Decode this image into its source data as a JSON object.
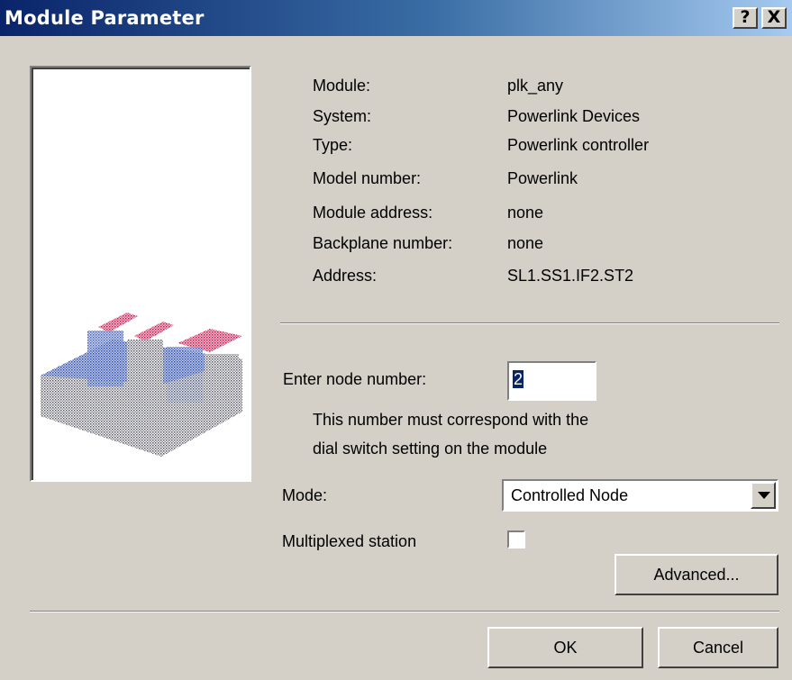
{
  "window": {
    "title": "Module Parameter",
    "help_glyph": "?",
    "close_glyph": "X"
  },
  "picture": {
    "icon": "powerlink-module-icon"
  },
  "info": {
    "module_label": "Module:",
    "module_value": "plk_any",
    "system_label": "System:",
    "system_value": "Powerlink Devices",
    "type_label": "Type:",
    "type_value": "Powerlink controller",
    "model_label": "Model number:",
    "model_value": "Powerlink",
    "module_address_label": "Module address:",
    "module_address_value": "none",
    "backplane_label": "Backplane number:",
    "backplane_value": "none",
    "address_label": "Address:",
    "address_value": "SL1.SS1.IF2.ST2"
  },
  "node": {
    "label": "Enter node number:",
    "value": "2",
    "hint_line1": "This number must correspond with the",
    "hint_line2": "dial switch setting on the module"
  },
  "mode": {
    "label": "Mode:",
    "selected": "Controlled Node"
  },
  "multiplexed": {
    "label": "Multiplexed station",
    "checked": false
  },
  "buttons": {
    "advanced": "Advanced...",
    "ok": "OK",
    "cancel": "Cancel"
  }
}
